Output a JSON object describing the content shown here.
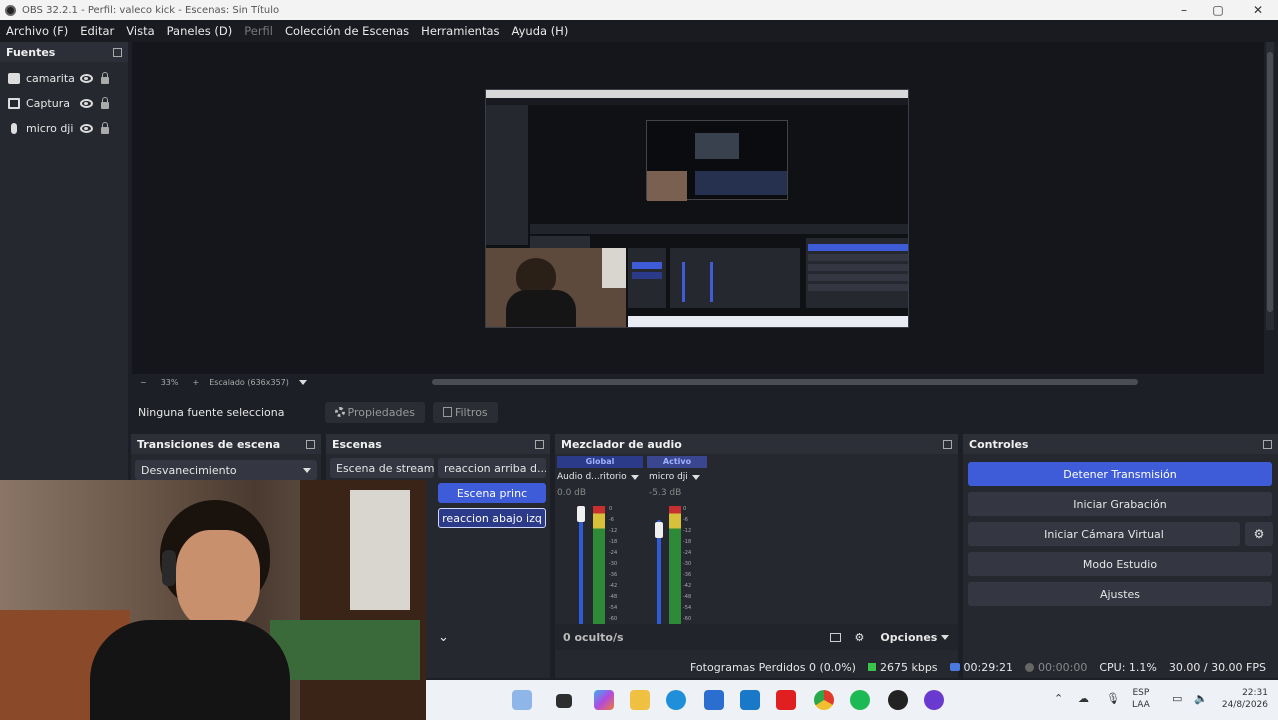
{
  "window": {
    "title": "OBS 32.2.1 - Perfil: valeco kick - Escenas: Sin Título"
  },
  "menu": [
    "Archivo (F)",
    "Editar",
    "Vista",
    "Paneles (D)",
    "Perfil",
    "Colección de Escenas",
    "Herramientas",
    "Ayuda (H)"
  ],
  "sources": {
    "title": "Fuentes",
    "items": [
      {
        "name": "camarita",
        "icon": "camera-icon"
      },
      {
        "name": "Captura d",
        "icon": "monitor-icon"
      },
      {
        "name": "micro dji",
        "icon": "microphone-icon"
      }
    ]
  },
  "preview": {
    "zoom": "33%",
    "scale_label": "Escalado (636x357)"
  },
  "source_toolbar": {
    "no_source": "Ninguna fuente selecciona",
    "properties": "Propiedades",
    "filters": "Filtros"
  },
  "transitions": {
    "title": "Transiciones de escena",
    "selected": "Desvanecimiento"
  },
  "scenes": {
    "title": "Escenas",
    "items": [
      "Escena de stream",
      "reaccion arriba d...",
      "Escena princ",
      "reaccion abajo izq"
    ]
  },
  "mixer": {
    "title": "Mezclador de audio",
    "tabs": [
      "Global",
      "Activo"
    ],
    "channels": [
      {
        "name": "Audio d...ritorio",
        "db": "0.0 dB",
        "level": 1.0
      },
      {
        "name": "micro dji",
        "db": "-5.3 dB",
        "level": 0.82
      }
    ],
    "scale": [
      "0",
      "-6",
      "-12",
      "-18",
      "-24",
      "-30",
      "-36",
      "-42",
      "-48",
      "-54",
      "-60"
    ],
    "hidden": "0 oculto/s",
    "options": "Opciones"
  },
  "controls": {
    "title": "Controles",
    "stop_stream": "Detener Transmisión",
    "start_recording": "Iniciar Grabación",
    "virtual_cam": "Iniciar Cámara Virtual",
    "studio_mode": "Modo Estudio",
    "settings": "Ajustes"
  },
  "status": {
    "dropped": "Fotogramas Perdidos 0 (0.0%)",
    "bitrate": "2675 kbps",
    "stream_time": "00:29:21",
    "rec_time": "00:00:00",
    "cpu": "CPU: 1.1%",
    "fps": "30.00 / 30.00 FPS"
  },
  "taskbar": {
    "lang1": "ESP",
    "lang2": "LAA",
    "time": "22:31",
    "date": "24/8/2026"
  },
  "colors": {
    "accent": "#3e5bd8",
    "panel": "#262830",
    "background": "#1d1f26"
  }
}
